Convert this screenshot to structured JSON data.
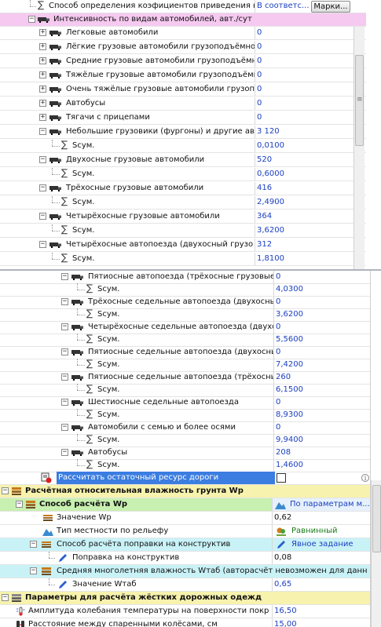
{
  "top": {
    "method_row": {
      "label": "Способ определения коэфициентов приведения к",
      "value": "В соответс...",
      "button": "Марки..."
    },
    "intensity_row": {
      "label": "Интенсивность по видам автомобилей, авт./сут"
    },
    "vehicles": [
      {
        "label": "Легковые автомобили",
        "value": "0"
      },
      {
        "label": "Лёгкие грузовые автомобили грузоподъёмнос",
        "value": "0"
      },
      {
        "label": "Средние грузовые автомобили грузоподъёмнос",
        "value": "0"
      },
      {
        "label": "Тяжёлые грузовые автомобили грузоподъёмн",
        "value": "0"
      },
      {
        "label": "Очень тяжёлые грузовые автомобили грузопо",
        "value": "0"
      },
      {
        "label": "Автобусы",
        "value": "0"
      },
      {
        "label": "Тягачи с прицепами",
        "value": "0"
      }
    ],
    "groups": [
      {
        "label": "Небольшие грузовики (фургоны) и другие авт",
        "value": "3 120",
        "sub_label": "Sсум.",
        "sub_value": "0,0100"
      },
      {
        "label": "Двухосные грузовые автомобили",
        "value": "520",
        "sub_label": "Sсум.",
        "sub_value": "0,6000"
      },
      {
        "label": "Трёхосные грузовые автомобили",
        "value": "416",
        "sub_label": "Sсум.",
        "sub_value": "2,4900"
      },
      {
        "label": "Четырёхосные грузовые автомобили",
        "value": "364",
        "sub_label": "Sсум.",
        "sub_value": "3,6200"
      },
      {
        "label": "Четырёхосные автопоезда (двухосный грузо",
        "value": "312",
        "sub_label": "Sсум.",
        "sub_value": "1,8100"
      }
    ]
  },
  "bottom": {
    "groups": [
      {
        "label": "Пятиосные автопоезда (трёхосные грузовые",
        "value": "0",
        "sub_label": "Sсум.",
        "sub_value": "4,0300"
      },
      {
        "label": "Трёхосные седельные автопоезда (двухосны",
        "value": "0",
        "sub_label": "Sсум.",
        "sub_value": "3,6200"
      },
      {
        "label": "Четырёхосные седельные автопоезда (двухо",
        "value": "0",
        "sub_label": "Sсум.",
        "sub_value": "5,5600"
      },
      {
        "label": "Пятиосные седельные автопоезда (двухосны",
        "value": "0",
        "sub_label": "Sсум.",
        "sub_value": "7,4200"
      },
      {
        "label": "Пятиосные седельные автопоезда (трёхосны",
        "value": "260",
        "sub_label": "Sсум.",
        "sub_value": "6,1500"
      },
      {
        "label": "Шестиосные седельные автопоезда",
        "value": "0",
        "sub_label": "Sсум.",
        "sub_value": "8,9300"
      },
      {
        "label": "Автомобили с семью и более осями",
        "value": "0",
        "sub_label": "Sсум.",
        "sub_value": "9,9400"
      },
      {
        "label": "Автобусы",
        "value": "208",
        "sub_label": "Sсум.",
        "sub_value": "1,4600"
      }
    ],
    "residual": {
      "label": "Рассчитать остаточный ресурс дороги",
      "checked": false
    },
    "humidity_section": {
      "label": "Расчётная относительная влажность грунта Wp"
    },
    "humidity_method": {
      "label": "Способ расчёта Wp",
      "value": "По параметрам м..."
    },
    "wp_value": {
      "label": "Значение Wp",
      "value": "0,62"
    },
    "terrain": {
      "label": "Тип местности по рельефу",
      "value": "Равнинный"
    },
    "correction_method": {
      "label": "Способ расчёта поправки на конструктив",
      "value": "Явное задание"
    },
    "correction": {
      "label": "Поправка на конструктив",
      "value": "0,08"
    },
    "avg_humidity": {
      "label": "Средняя многолетняя влажность Wтаб (авторасчёт невозможен для данн..."
    },
    "wtab_value": {
      "label": "Значение Wтаб",
      "value": "0,65"
    },
    "rigid_section": {
      "label": "Параметры для расчёта жёстких дорожных одежд"
    },
    "amplitude": {
      "label": "Амплитуда колебания температуры на поверхности покр",
      "value": "16,50"
    },
    "wheel_distance": {
      "label": "Расстояние между спаренными колёсами, см",
      "value": "15,00"
    }
  },
  "colors": {
    "value_blue": "#1b3fbf",
    "pink": "#f5c9f0",
    "selection_blue": "#3b7de0",
    "cyan": "#c9f2f7",
    "green": "#c8f0b0",
    "yellow": "#f7f2ad"
  }
}
